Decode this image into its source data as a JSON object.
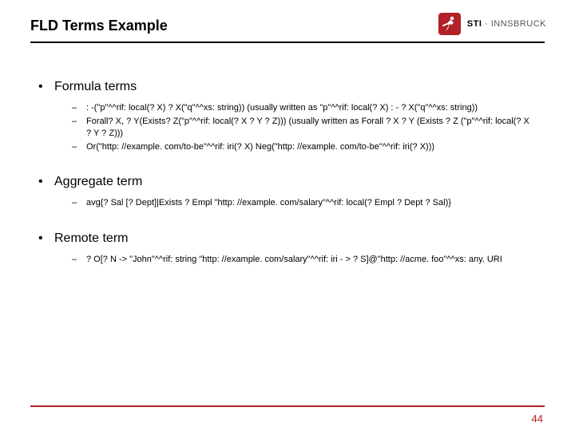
{
  "title": "FLD Terms Example",
  "logo": {
    "sti": "STI",
    "sep": " · ",
    "inns": "INNSBRUCK"
  },
  "sections": [
    {
      "heading": "Formula terms",
      "items": [
        " : -(\"p\"^^rif: local(? X) ? X(\"q\"^^xs: string)) (usually written as \"p\"^^rif: local(? X) : - ? X(\"q\"^^xs: string))",
        "Forall? X, ? Y(Exists? Z(\"p\"^^rif: local(? X ? Y ? Z))) (usually written as Forall ? X ? Y (Exists ? Z (\"p\"^^rif: local(? X ? Y ? Z)))",
        "Or(\"http: //example. com/to-be\"^^rif: iri(? X) Neg(\"http: //example. com/to-be\"^^rif: iri(? X)))"
      ]
    },
    {
      "heading": "Aggregate term",
      "items": [
        "avg{? Sal [? Dept]|Exists ? Empl \"http: //example. com/salary\"^^rif: local(? Empl ? Dept ? Sal)}"
      ]
    },
    {
      "heading": "Remote term",
      "items": [
        "? O[? N -> \"John\"^^rif: string \"http: //example. com/salary\"^^rif: iri - > ? S]@\"http: //acme. foo\"^^xs: any. URI"
      ]
    }
  ],
  "page_number": "44"
}
